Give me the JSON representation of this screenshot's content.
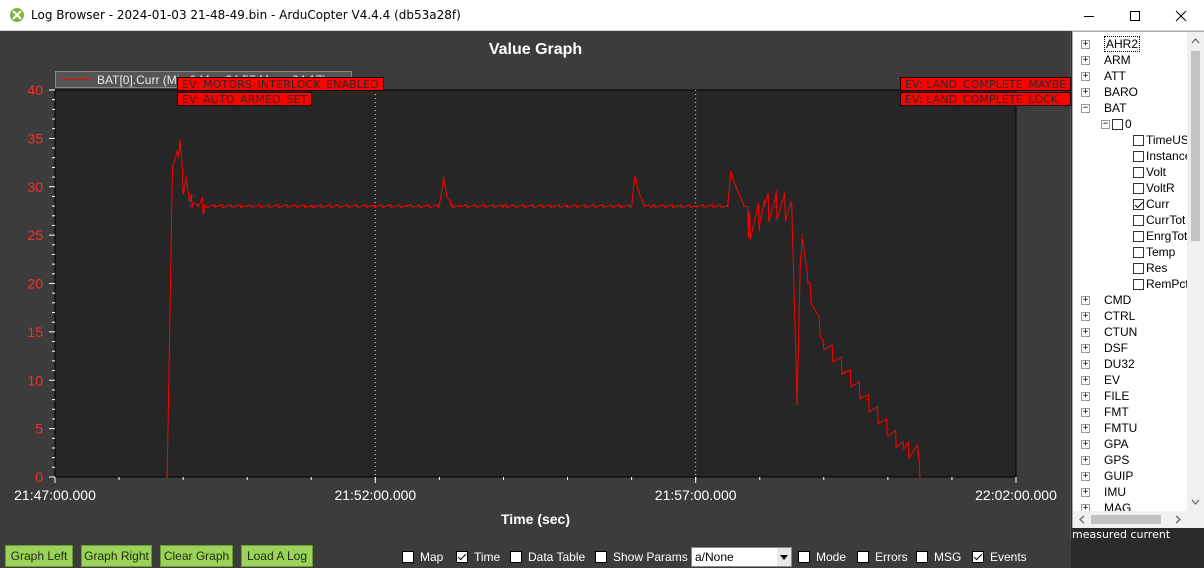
{
  "window": {
    "title": "Log Browser - 2024-01-03 21-48-49.bin - ArduCopter V4.4.4 (db53a28f)"
  },
  "graph": {
    "title": "Value Graph",
    "legend": "BAT[0].Curr  (Min:0 Max:34.57 Mean:24.17)",
    "events": [
      "EV: MOTORS_INTERLOCK_ENABLED",
      "EV: AUTO_ARMED_SET",
      "EV: LAND_COMPLETE_MAYBE",
      "EV: LAND_COMPLETE_LOCK"
    ]
  },
  "chart_data": {
    "type": "line",
    "title": "Value Graph",
    "xlabel": "Time (sec)",
    "ylabel": "",
    "x_ticks": [
      "21:47:00.000",
      "21:52:00.000",
      "21:57:00.000",
      "22:02:00.000"
    ],
    "y_ticks": [
      "0",
      "5",
      "10",
      "15",
      "20",
      "25",
      "30",
      "35",
      "40"
    ],
    "ylim": [
      0,
      40
    ],
    "xlim": [
      "21:47:00",
      "22:02:00"
    ],
    "grid": "x-major-dotted",
    "legend_position": "top-left",
    "series": [
      {
        "name": "BAT[0].Curr",
        "color": "#ff0000",
        "x": [
          "21:48:45",
          "21:48:50",
          "21:48:57",
          "21:49:00",
          "21:49:03",
          "21:49:06",
          "21:49:10",
          "21:49:14",
          "21:49:20",
          "21:49:30",
          "21:50:00",
          "21:51:00",
          "21:52:00",
          "21:52:30",
          "21:53:00",
          "21:53:04",
          "21:53:07",
          "21:53:12",
          "21:53:20",
          "21:54:00",
          "21:55:00",
          "21:56:00",
          "21:56:03",
          "21:56:07",
          "21:56:12",
          "21:56:20",
          "21:57:00",
          "21:57:30",
          "21:57:33",
          "21:57:38",
          "21:57:45",
          "21:57:50",
          "21:58:00",
          "21:58:05",
          "21:58:15",
          "21:58:30",
          "21:58:35",
          "21:58:38",
          "21:58:40",
          "21:58:45",
          "21:59:00",
          "21:59:20",
          "21:59:40",
          "22:00:00",
          "22:00:15",
          "22:00:28",
          "22:00:30"
        ],
        "y": [
          0,
          32,
          34.5,
          30,
          31,
          28,
          29,
          28,
          28,
          28,
          28,
          28,
          28,
          28,
          28,
          31,
          29,
          28,
          28,
          28,
          28,
          28,
          31,
          29.5,
          28,
          28,
          28,
          28,
          31.5,
          30,
          28,
          26,
          27,
          28,
          28,
          28,
          7.5,
          22,
          25,
          20,
          14,
          11,
          8,
          5,
          3,
          2.5,
          0
        ]
      }
    ]
  },
  "axes": {
    "x_title": "Time (sec)"
  },
  "tree": {
    "items": [
      {
        "label": "AHR2",
        "type": "group",
        "expanded": false
      },
      {
        "label": "ARM",
        "type": "group",
        "expanded": false
      },
      {
        "label": "ATT",
        "type": "group",
        "expanded": false
      },
      {
        "label": "BARO",
        "type": "group",
        "expanded": false
      },
      {
        "label": "BAT",
        "type": "group",
        "expanded": true
      },
      {
        "label": "0",
        "type": "instance",
        "expanded": true
      },
      {
        "label": "TimeUS",
        "type": "field",
        "checked": false
      },
      {
        "label": "Instance",
        "type": "field",
        "checked": false
      },
      {
        "label": "Volt",
        "type": "field",
        "checked": false
      },
      {
        "label": "VoltR",
        "type": "field",
        "checked": false
      },
      {
        "label": "Curr",
        "type": "field",
        "checked": true
      },
      {
        "label": "CurrTot",
        "type": "field",
        "checked": false
      },
      {
        "label": "EnrgTot",
        "type": "field",
        "checked": false
      },
      {
        "label": "Temp",
        "type": "field",
        "checked": false
      },
      {
        "label": "Res",
        "type": "field",
        "checked": false
      },
      {
        "label": "RemPct",
        "type": "field",
        "checked": false
      },
      {
        "label": "CMD",
        "type": "group",
        "expanded": false
      },
      {
        "label": "CTRL",
        "type": "group",
        "expanded": false
      },
      {
        "label": "CTUN",
        "type": "group",
        "expanded": false
      },
      {
        "label": "DSF",
        "type": "group",
        "expanded": false
      },
      {
        "label": "DU32",
        "type": "group",
        "expanded": false
      },
      {
        "label": "EV",
        "type": "group",
        "expanded": false
      },
      {
        "label": "FILE",
        "type": "group",
        "expanded": false
      },
      {
        "label": "FMT",
        "type": "group",
        "expanded": false
      },
      {
        "label": "FMTU",
        "type": "group",
        "expanded": false
      },
      {
        "label": "GPA",
        "type": "group",
        "expanded": false
      },
      {
        "label": "GPS",
        "type": "group",
        "expanded": false
      },
      {
        "label": "GUIP",
        "type": "group",
        "expanded": false
      },
      {
        "label": "IMU",
        "type": "group",
        "expanded": false
      },
      {
        "label": "MAG",
        "type": "group",
        "expanded": false
      }
    ],
    "status": "measured current"
  },
  "toolbar": {
    "graph_left": "Graph Left",
    "graph_right": "Graph Right",
    "clear_graph": "Clear Graph",
    "load_log": "Load A Log",
    "map": {
      "label": "Map",
      "checked": false
    },
    "time": {
      "label": "Time",
      "checked": true
    },
    "data_table": {
      "label": "Data Table",
      "checked": false
    },
    "show_params": {
      "label": "Show Params",
      "checked": false
    },
    "select_value": "a/None",
    "mode": {
      "label": "Mode",
      "checked": false
    },
    "errors": {
      "label": "Errors",
      "checked": false
    },
    "msg": {
      "label": "MSG",
      "checked": false
    },
    "events": {
      "label": "Events",
      "checked": true
    }
  }
}
